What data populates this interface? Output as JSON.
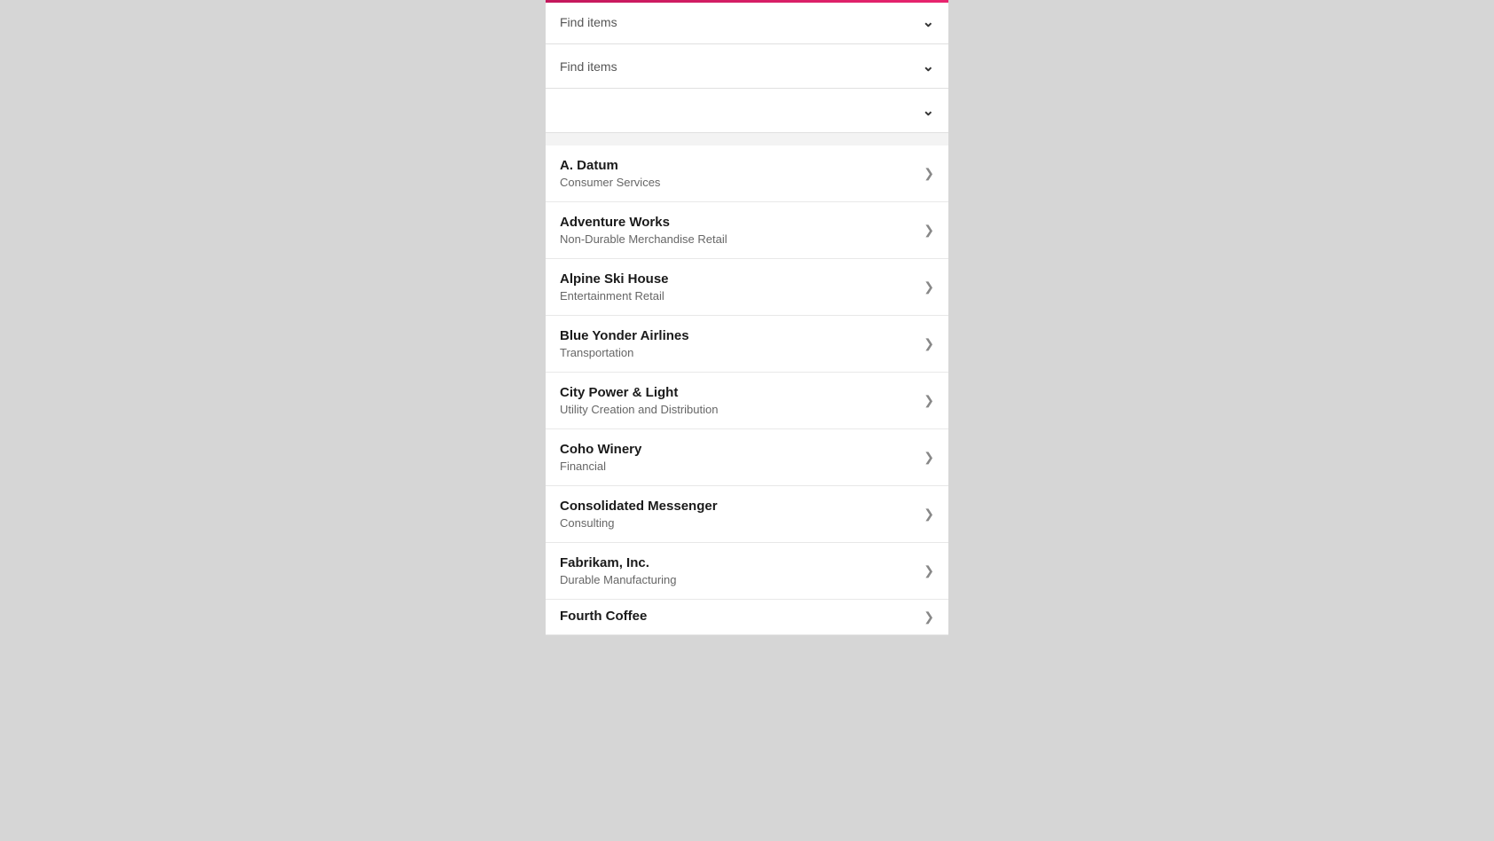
{
  "filters": [
    {
      "id": "filter1",
      "placeholder": "Find items",
      "has_placeholder": true
    },
    {
      "id": "filter2",
      "placeholder": "Find items",
      "has_placeholder": true
    },
    {
      "id": "filter3",
      "placeholder": "",
      "has_placeholder": false
    }
  ],
  "chevron_down": "⌄",
  "chevron_right": "❯",
  "list_items": [
    {
      "id": "a-datum",
      "title": "A. Datum",
      "subtitle": "Consumer Services"
    },
    {
      "id": "adventure-works",
      "title": "Adventure Works",
      "subtitle": "Non-Durable Merchandise Retail"
    },
    {
      "id": "alpine-ski-house",
      "title": "Alpine Ski House",
      "subtitle": "Entertainment Retail"
    },
    {
      "id": "blue-yonder-airlines",
      "title": "Blue Yonder Airlines",
      "subtitle": "Transportation"
    },
    {
      "id": "city-power-light",
      "title": "City Power & Light",
      "subtitle": "Utility Creation and Distribution"
    },
    {
      "id": "coho-winery",
      "title": "Coho Winery",
      "subtitle": "Financial"
    },
    {
      "id": "consolidated-messenger",
      "title": "Consolidated Messenger",
      "subtitle": "Consulting"
    },
    {
      "id": "fabrikam-inc",
      "title": "Fabrikam, Inc.",
      "subtitle": "Durable Manufacturing"
    },
    {
      "id": "fourth-coffee",
      "title": "Fourth Coffee",
      "subtitle": ""
    }
  ],
  "colors": {
    "progress_bar": "#c3185c",
    "background": "#d6d6d6",
    "panel_bg": "#f3f3f3",
    "item_bg": "#ffffff",
    "border": "#e0e0e0"
  }
}
